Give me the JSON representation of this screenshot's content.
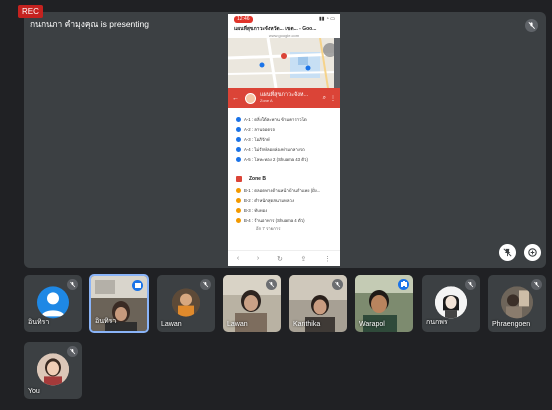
{
  "recording": {
    "badge": "REC"
  },
  "presentation": {
    "presenter_label": "กนกนภา คำมุงคุณ is presenting",
    "phone": {
      "status_time": "12:46",
      "url_title": "แผนที่สุขภาวะจังหวัด... เขต... - Goo...",
      "url_sub": "www.google.com",
      "app_title": "แผนที่สุขภาวะจังห...",
      "app_subtitle": "Zone A",
      "zone_a_items": [
        {
          "label": "A-1 : ตลิ่งใต้สะพาน ข้ามคาราวโต",
          "color": "#1a73e8"
        },
        {
          "label": "A-2 : ลานจอดรถ",
          "color": "#1a73e8"
        },
        {
          "label": "A-3 : โอภิรักษ์",
          "color": "#1a73e8"
        },
        {
          "label": "A-4 : ไม่รักษ์ลอยล่องท่ามกลางรถ",
          "color": "#1a73e8"
        },
        {
          "label": "A-5 : โลหะทอง 2 (Shuama 43 ตัว)",
          "color": "#1a73e8"
        }
      ],
      "zone_b_title": "Zone B",
      "zone_b_items": [
        {
          "label": "B-1 : ตลอดทางด้านหน้าบ้านกำแพง (ฝั่ง...",
          "color": "#f29900"
        },
        {
          "label": "B-2 : ตำหนักสุดสนามหลวง",
          "color": "#f29900"
        },
        {
          "label": "B-3 : ทับทอง",
          "color": "#f29900"
        },
        {
          "label": "B-4 : ร้านอาหาร (Shuama 4 ตัว)",
          "color": "#f29900"
        }
      ],
      "more_label": "อีก 7 รายการ"
    }
  },
  "participants": [
    {
      "name": "อินทิรา",
      "kind": "avatar",
      "avatar_color": "#1e88e5",
      "muted": true,
      "active": false
    },
    {
      "name": "อินทิรา",
      "kind": "video",
      "muted": false,
      "active": true
    },
    {
      "name": "Lawan",
      "kind": "avatar-photo",
      "muted": true,
      "active": false
    },
    {
      "name": "Lawan",
      "kind": "video",
      "muted": true,
      "active": false
    },
    {
      "name": "Kanthika",
      "kind": "video",
      "muted": true,
      "active": false
    },
    {
      "name": "Warapol",
      "kind": "video",
      "muted": false,
      "speaking": true,
      "active": false
    },
    {
      "name": "กนกพร",
      "kind": "avatar-photo",
      "muted": true,
      "active": false
    },
    {
      "name": "Phraengoen",
      "kind": "avatar-photo",
      "muted": true,
      "active": false
    },
    {
      "name": "You",
      "kind": "avatar-photo",
      "muted": true,
      "active": false
    }
  ],
  "icons": {
    "tile_mute": "mic-off-icon",
    "pin": "pin-off-icon",
    "fullscreen": "fullscreen-icon"
  }
}
